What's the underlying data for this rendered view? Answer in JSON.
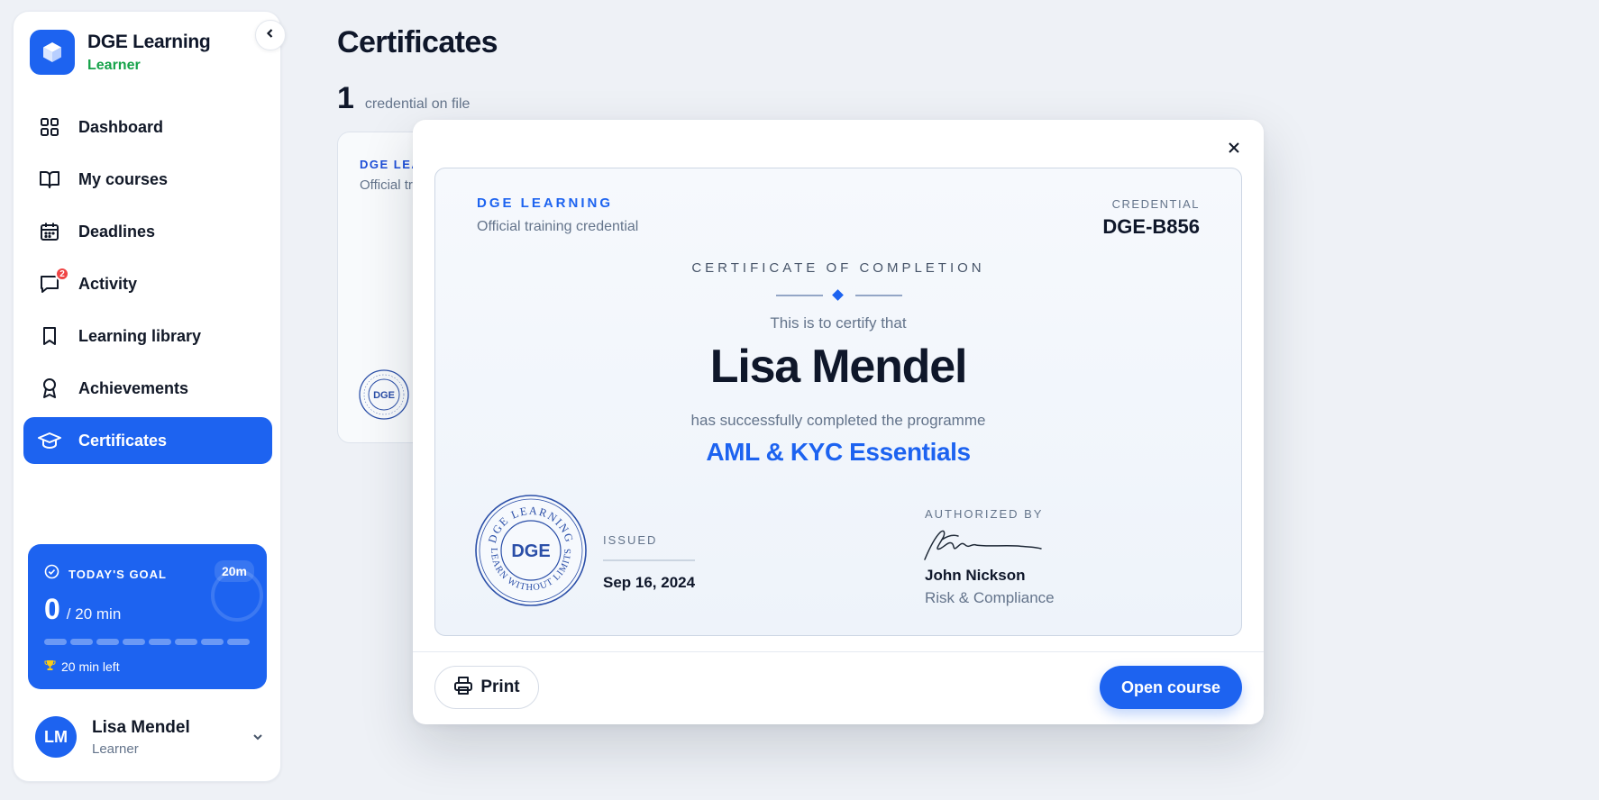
{
  "brand": {
    "name": "DGE Learning",
    "role": "Learner"
  },
  "nav": {
    "items": [
      {
        "label": "Dashboard",
        "icon": "grid-icon"
      },
      {
        "label": "My courses",
        "icon": "book-open-icon"
      },
      {
        "label": "Deadlines",
        "icon": "calendar-icon"
      },
      {
        "label": "Activity",
        "icon": "message-icon",
        "badge": "2"
      },
      {
        "label": "Learning library",
        "icon": "bookmark-icon"
      },
      {
        "label": "Achievements",
        "icon": "award-icon"
      },
      {
        "label": "Certificates",
        "icon": "graduation-cap-icon",
        "active": true
      }
    ]
  },
  "goal": {
    "title": "TODAY'S GOAL",
    "target_badge": "20m",
    "value": "0",
    "unit": "/ 20 min",
    "progress_segments": 8,
    "progress_filled": 0,
    "time_left": "20 min left"
  },
  "user": {
    "initials": "LM",
    "name": "Lisa Mendel",
    "role": "Learner"
  },
  "main": {
    "title": "Certificates",
    "count": "1",
    "count_label": "credential on file",
    "card": {
      "org": "DGE LEA",
      "subtitle": "Official tr",
      "seal_text": "DGE"
    }
  },
  "modal": {
    "certificate": {
      "org": "DGE LEARNING",
      "org_subtitle": "Official training credential",
      "credential_label": "CREDENTIAL",
      "credential_id": "DGE-B856",
      "kind": "CERTIFICATE OF COMPLETION",
      "preamble": "This is to certify that",
      "recipient": "Lisa Mendel",
      "middle": "has successfully completed the programme",
      "course": "AML & KYC Essentials",
      "seal": {
        "center": "DGE",
        "top_text": "DGE LEARNING",
        "bottom_text": "LEARN WITHOUT LIMITS"
      },
      "issued_label": "ISSUED",
      "issued_date": "Sep 16, 2024",
      "authorized_label": "AUTHORIZED BY",
      "authorized_name": "John Nickson",
      "authorized_title": "Risk & Compliance"
    },
    "print_label": "Print",
    "open_label": "Open course"
  },
  "colors": {
    "accent": "#1d63f0",
    "success": "#16a34a",
    "badge": "#ef4444",
    "background": "#eef1f6"
  }
}
